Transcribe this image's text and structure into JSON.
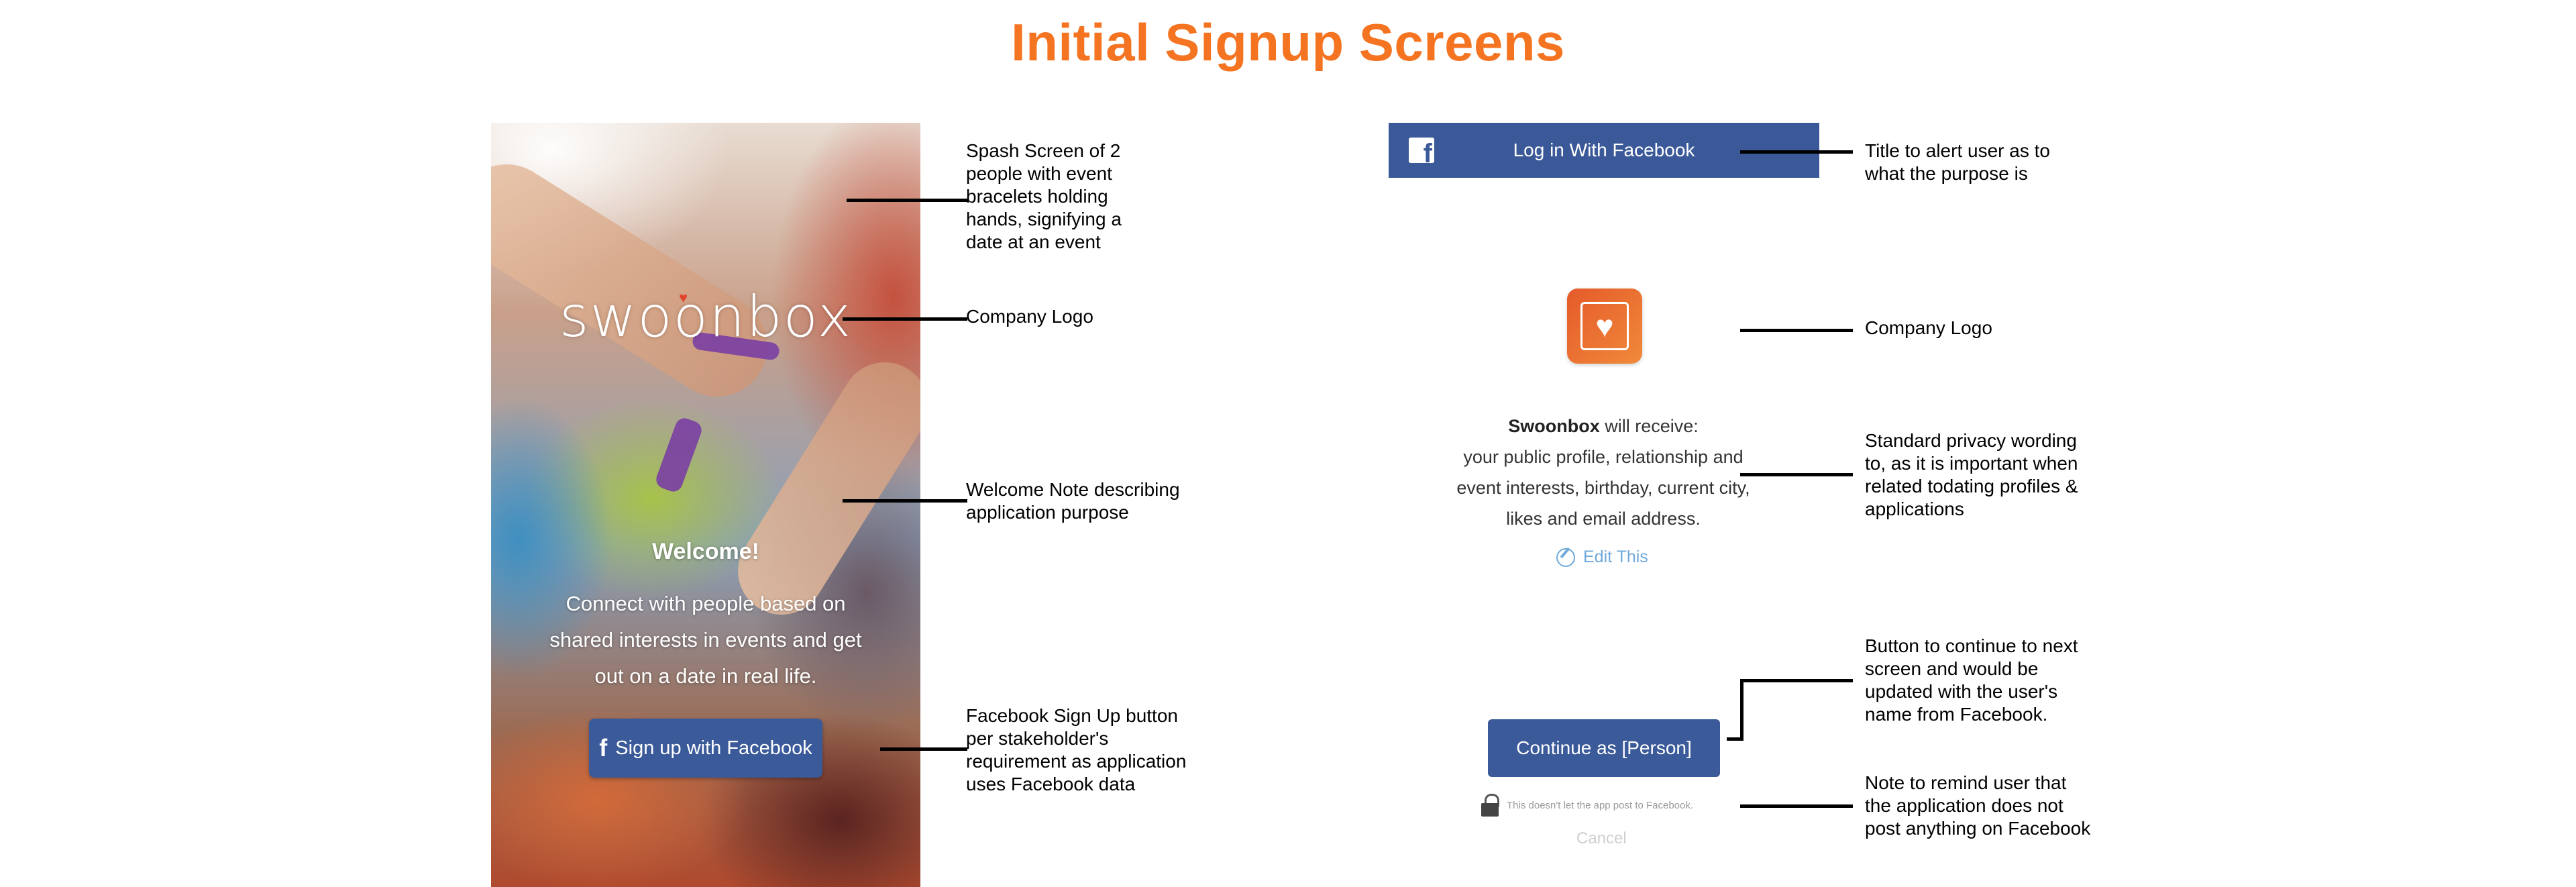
{
  "page_title": "Initial Signup Screens",
  "splash": {
    "logo_text": "swoonbox",
    "welcome_heading": "Welcome!",
    "welcome_lines": [
      "Connect with people based on",
      "shared interests in events and get",
      "out on a date in real life."
    ],
    "signup_button": "Sign up with Facebook",
    "signup_icon": "facebook-f-icon"
  },
  "facebook_auth": {
    "header_title": "Log in With Facebook",
    "header_icon": "facebook-logo-icon",
    "app_icon": "heart-app-icon",
    "privacy_app_name": "Swoonbox",
    "privacy_first_line_rest": " will receive:",
    "privacy_lines": [
      "your public profile, relationship and",
      "event interests, birthday, current city,",
      "likes and email address."
    ],
    "edit_link": "Edit This",
    "continue_button": "Continue as [Person]",
    "lock_note": "This doesn't let the app post to Facebook.",
    "cancel": "Cancel"
  },
  "annotations": {
    "splash_image": [
      "Spash Screen of 2",
      "people with event",
      "bracelets holding",
      "hands, signifying a",
      "date at an event"
    ],
    "company_logo_left": [
      "Company Logo"
    ],
    "welcome_note": [
      "Welcome Note describing",
      "application purpose"
    ],
    "fb_signup": [
      "Facebook Sign Up button",
      "per stakeholder's",
      "requirement as application",
      "uses Facebook data"
    ],
    "title_note": [
      "Title to alert user as to",
      "what the purpose is"
    ],
    "company_logo_right": [
      "Company Logo"
    ],
    "privacy_note": [
      "Standard privacy wording",
      "to, as it is important when",
      "related todating profiles &",
      "applications"
    ],
    "continue_note": [
      "Button to continue to next",
      "screen and would be",
      "updated with the user's",
      "name from Facebook."
    ],
    "post_note": [
      "Note to remind user that",
      "the application does not",
      "post anything on Facebook"
    ]
  },
  "colors": {
    "title_orange": "#f47421",
    "facebook_blue": "#3b5998",
    "link_blue": "#6fa8dc"
  }
}
